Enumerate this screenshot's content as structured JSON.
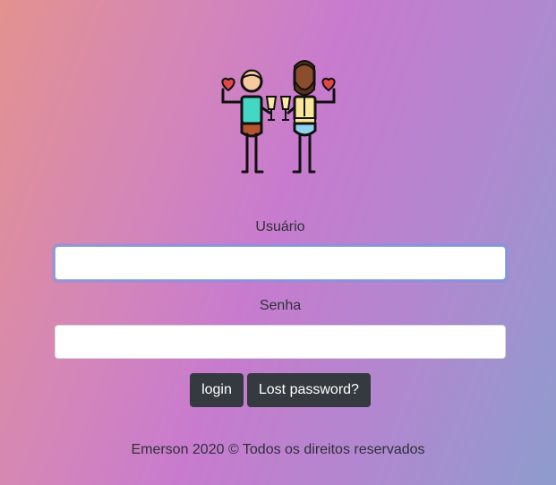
{
  "illustration": {
    "icon": "couple-toast-icon",
    "colors": {
      "outline": "#111111",
      "skin_light": "#f6c9a0",
      "shirt": "#44d8c4",
      "pants": "#b5542e",
      "skin_dark": "#8a4e2c",
      "beard": "#5a2f17",
      "vest": "#fbe79a",
      "jeans": "#8fd3ee",
      "heart": "#e04848",
      "glass": "#fde9a8"
    }
  },
  "form": {
    "username_label": "Usuário",
    "username_value": "",
    "password_label": "Senha",
    "password_value": "",
    "login_label": "login",
    "lost_password_label": "Lost password?"
  },
  "footer": {
    "text": "Emerson 2020 © Todos os direitos reservados"
  },
  "theme": {
    "button_bg": "#343a40",
    "focus_ring": "#8aaee8"
  }
}
